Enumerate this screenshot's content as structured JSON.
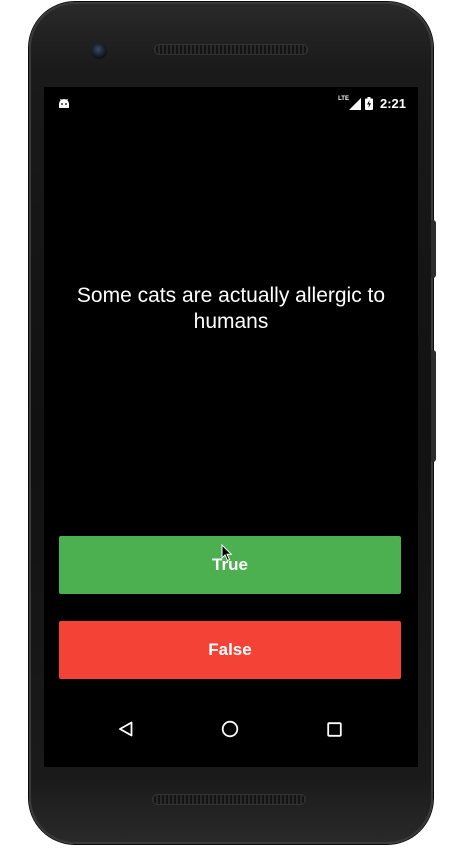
{
  "status_bar": {
    "network_label": "LTE",
    "time": "2:21"
  },
  "quiz": {
    "question": "Some cats are actually allergic to humans",
    "true_label": "True",
    "false_label": "False"
  },
  "colors": {
    "true_button": "#4caf50",
    "false_button": "#f44336",
    "screen_background": "#000000"
  },
  "icons": {
    "status_left": "android-debug-icon",
    "signal": "signal-icon",
    "battery": "battery-charging-icon",
    "nav_back": "back-triangle-icon",
    "nav_home": "home-circle-icon",
    "nav_recents": "recents-square-icon"
  }
}
